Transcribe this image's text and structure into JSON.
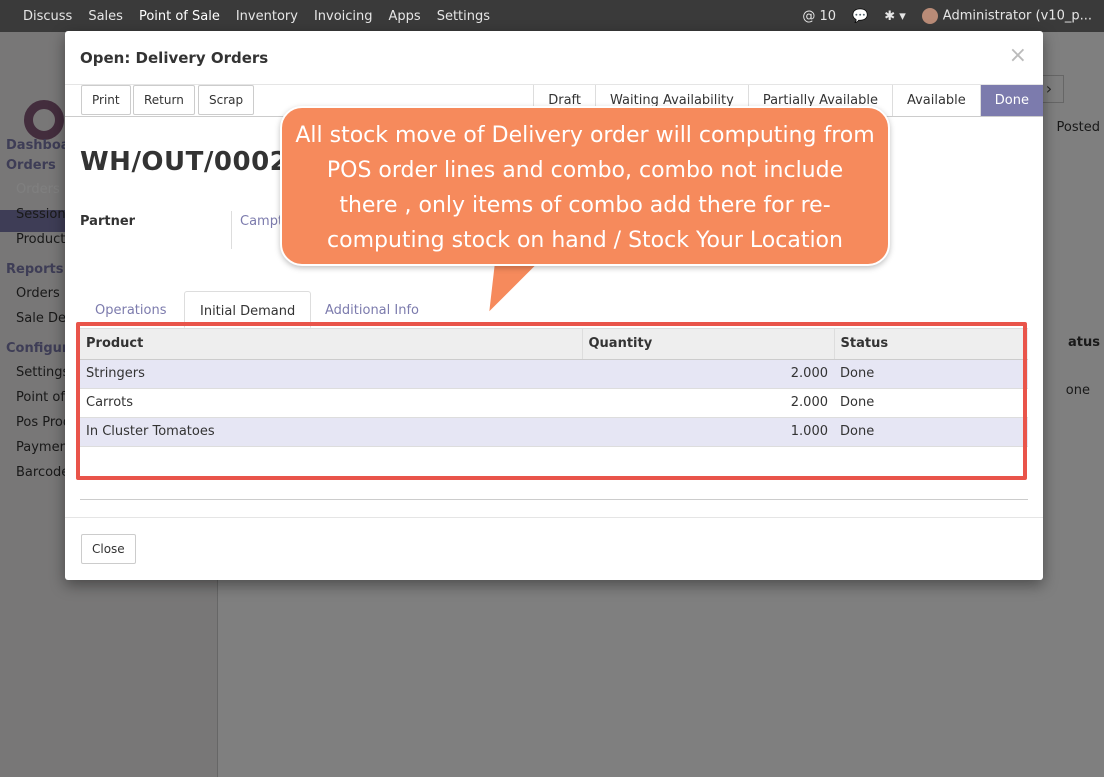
{
  "topbar": {
    "menu": [
      "Discuss",
      "Sales",
      "Point of Sale",
      "Inventory",
      "Invoicing",
      "Apps",
      "Settings"
    ],
    "messages": "@ 10",
    "user": "Administrator (v10_p..."
  },
  "background": {
    "sidebar": {
      "dashboard": "Dashboa",
      "orders_section": "Orders",
      "orders": "Orders",
      "sessions": "Sessions",
      "products": "Product",
      "reports": "Reports",
      "report_orders": "Orders",
      "sale_details": "Sale Det",
      "configuration": "Configur",
      "settings": "Settings",
      "point_of": "Point of",
      "pos_prod": "Pos Prod",
      "payment": "Paymen",
      "barcode": "Barcode"
    },
    "main": {
      "posted": "Posted",
      "status": "atus",
      "done": "one"
    }
  },
  "modal": {
    "title": "Open: Delivery Orders",
    "close_x": "×",
    "buttons": {
      "print": "Print",
      "return": "Return",
      "scrap": "Scrap",
      "close": "Close"
    },
    "stages": [
      "Draft",
      "Waiting Availability",
      "Partially Available",
      "Available",
      "Done"
    ],
    "reference": "WH/OUT/0002",
    "partner_label": "Partner",
    "partner_value": "Campt",
    "tabs": [
      "Operations",
      "Initial Demand",
      "Additional Info"
    ],
    "table": {
      "headers": [
        "Product",
        "Quantity",
        "Status"
      ],
      "rows": [
        {
          "product": "Stringers",
          "quantity": "2.000",
          "status": "Done"
        },
        {
          "product": "Carrots",
          "quantity": "2.000",
          "status": "Done"
        },
        {
          "product": "In Cluster Tomatoes",
          "quantity": "1.000",
          "status": "Done"
        }
      ]
    }
  },
  "callout": {
    "line1": "All stock move of Delivery order will computing from",
    "line2": "POS order lines and combo, combo not include",
    "line3": "there , only items of combo add there for re-",
    "line4": "computing stock on hand / Stock Your Location"
  },
  "colors": {
    "accent": "#7c7bad",
    "callout": "#f68a5c",
    "highlight": "#e9544a"
  }
}
